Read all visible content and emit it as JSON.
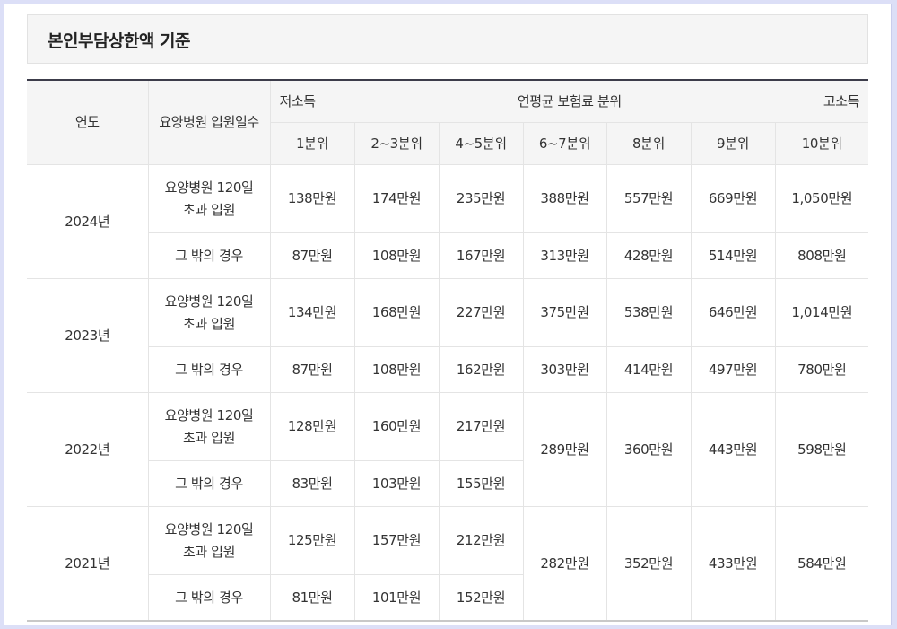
{
  "title": "본인부담상한액 기준",
  "headers": {
    "year": "연도",
    "days": "요양병원 입원일수",
    "low": "저소득",
    "middle": "연평균 보험료 분위",
    "high": "고소득",
    "deciles": [
      "1분위",
      "2~3분위",
      "4~5분위",
      "6~7분위",
      "8분위",
      "9분위",
      "10분위"
    ]
  },
  "rows": [
    {
      "year": "2024년",
      "a": {
        "label": "요양병원 120일 초과 입원",
        "values": [
          "138만원",
          "174만원",
          "235만원",
          "388만원",
          "557만원",
          "669만원",
          "1,050만원"
        ]
      },
      "b": {
        "label": "그 밖의 경우",
        "values": [
          "87만원",
          "108만원",
          "167만원",
          "313만원",
          "428만원",
          "514만원",
          "808만원"
        ]
      }
    },
    {
      "year": "2023년",
      "a": {
        "label": "요양병원 120일 초과 입원",
        "values": [
          "134만원",
          "168만원",
          "227만원",
          "375만원",
          "538만원",
          "646만원",
          "1,014만원"
        ]
      },
      "b": {
        "label": "그 밖의 경우",
        "values": [
          "87만원",
          "108만원",
          "162만원",
          "303만원",
          "414만원",
          "497만원",
          "780만원"
        ]
      }
    },
    {
      "year": "2022년",
      "a": {
        "label": "요양병원 120일 초과 입원",
        "values": [
          "128만원",
          "160만원",
          "217만원"
        ]
      },
      "b": {
        "label": "그 밖의 경우",
        "values": [
          "83만원",
          "103만원",
          "155만원"
        ]
      },
      "shared": [
        "289만원",
        "360만원",
        "443만원",
        "598만원"
      ]
    },
    {
      "year": "2021년",
      "a": {
        "label": "요양병원 120일 초과 입원",
        "values": [
          "125만원",
          "157만원",
          "212만원"
        ]
      },
      "b": {
        "label": "그 밖의 경우",
        "values": [
          "81만원",
          "101만원",
          "152만원"
        ]
      },
      "shared": [
        "282만원",
        "352만원",
        "433만원",
        "584만원"
      ]
    }
  ]
}
